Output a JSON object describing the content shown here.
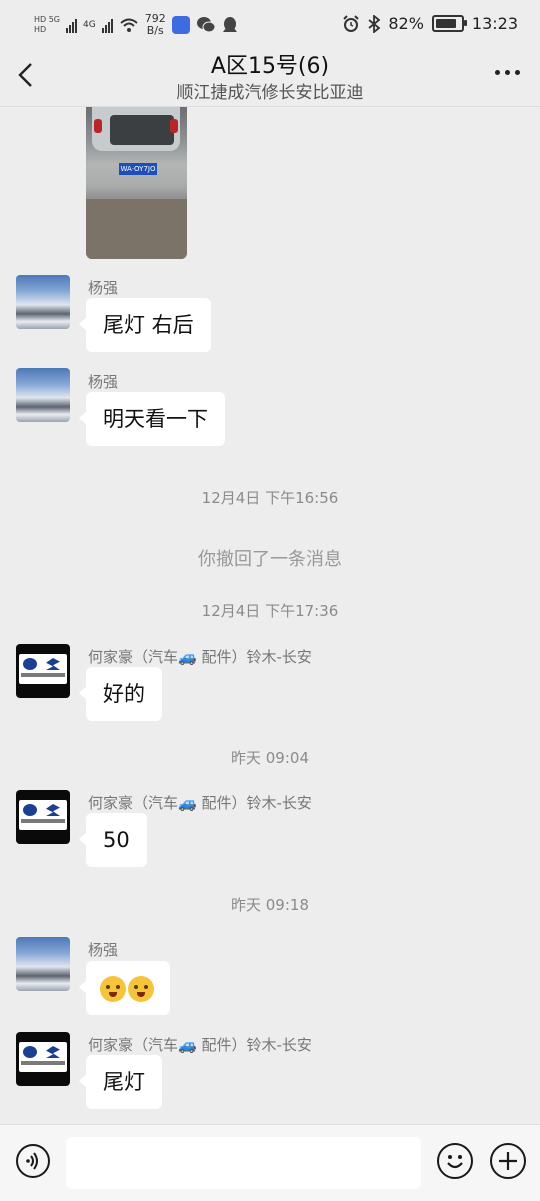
{
  "status_bar": {
    "net_label_1": "HD 5G",
    "net_label_2": "HD",
    "net_label_3": "4G",
    "speed_value": "792",
    "speed_unit": "B/s",
    "battery": "82%",
    "time": "13:23",
    "battery_level": 0.82
  },
  "header": {
    "title": "A区15号(6)",
    "subtitle": "顺江捷成汽修长安比亚迪"
  },
  "chat": {
    "image_plate": "WA·OY7JO",
    "messages": [
      {
        "sender": "杨强",
        "text": "尾灯  右后"
      },
      {
        "sender": "杨强",
        "text": "明天看一下"
      },
      {
        "time": "12月4日 下午16:56"
      },
      {
        "system": "你撤回了一条消息"
      },
      {
        "time": "12月4日 下午17:36"
      },
      {
        "sender": "何家豪（汽车🚙 配件）铃木-长安",
        "text": "好的"
      },
      {
        "time": "昨天 09:04"
      },
      {
        "sender": "何家豪（汽车🚙 配件）铃木-长安",
        "text": "50"
      },
      {
        "time": "昨天 09:18"
      },
      {
        "sender": "杨强",
        "text": ""
      },
      {
        "sender": "何家豪（汽车🚙 配件）铃木-长安",
        "text": "尾灯"
      }
    ]
  },
  "input_bar": {
    "placeholder": ""
  }
}
